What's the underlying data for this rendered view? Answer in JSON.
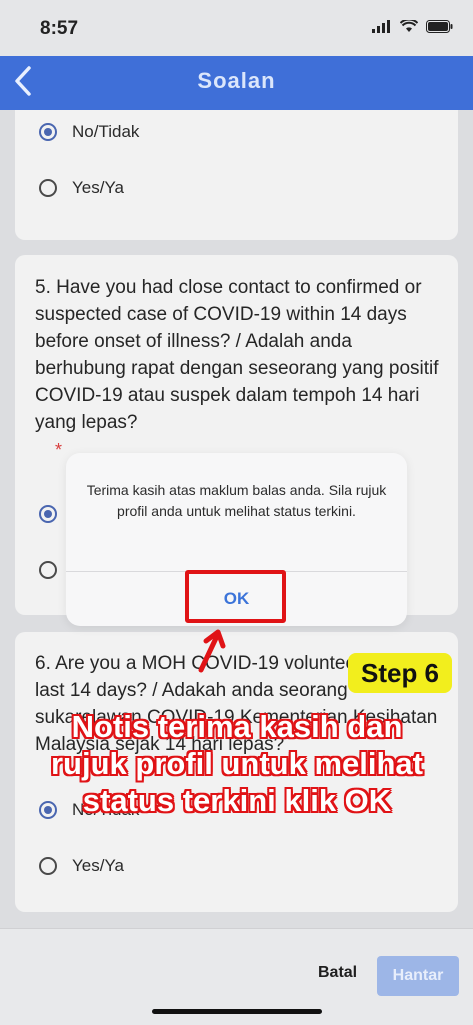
{
  "status": {
    "time": "8:57"
  },
  "nav": {
    "back_icon": "chevron-left-icon",
    "title": "Soalan"
  },
  "q4": {
    "options": [
      {
        "label": "No/Tidak",
        "checked": true
      },
      {
        "label": "Yes/Ya",
        "checked": false
      }
    ]
  },
  "q5": {
    "text": "5.  Have you had close contact to confirmed or suspected case of COVID-19 within 14 days before onset of illness? / Adalah anda berhubung rapat dengan seseorang yang positif COVID-19 atau suspek dalam tempoh 14 hari yang lepas?",
    "required": "*"
  },
  "q6": {
    "text": "6.  Are you a MOH COVID-19 volunteer in the last 14 days? / Adakah anda seorang sukarelawan COVID-19 Kementerian Kesihatan Malaysia sejak 14 hari lepas?",
    "options": [
      {
        "label": "No/Tidak",
        "checked": true
      },
      {
        "label": "Yes/Ya",
        "checked": false
      }
    ]
  },
  "dialog": {
    "message": "Terima kasih atas maklum balas anda. Sila rujuk profil anda untuk melihat status terkini.",
    "ok_label": "OK"
  },
  "footer": {
    "cancel_label": "Batal",
    "submit_label": "Hantar"
  },
  "annotation": {
    "step": "Step 6",
    "text": "Notis terima kasih dan rujuk profil untuk melihat status terkini klik OK"
  },
  "colors": {
    "nav": "#3f6fd8",
    "accent_red": "#e01316",
    "badge_yellow": "#f2ee1d"
  }
}
